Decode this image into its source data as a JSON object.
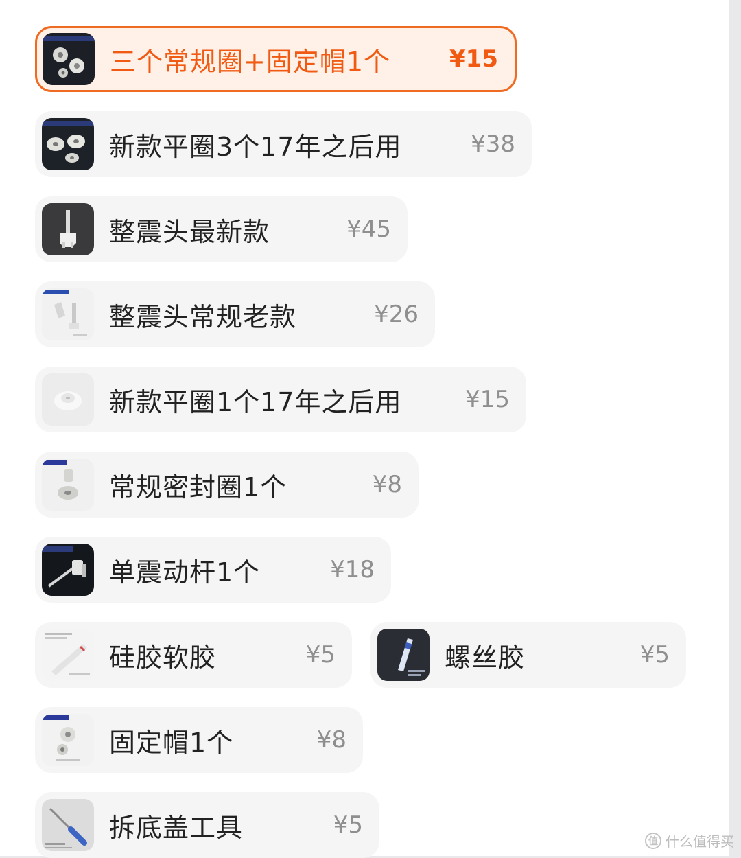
{
  "colors": {
    "accent": "#f05a12",
    "selected_border": "#f06b22",
    "option_bg": "#f5f5f5"
  },
  "options": [
    {
      "label": "三个常规圈+固定帽1个",
      "price": "¥15",
      "selected": true,
      "icon": "seal-rings-with-cap-thumbnail"
    },
    {
      "label": "新款平圈3个17年之后用",
      "price": "¥38",
      "selected": false,
      "icon": "flat-rings-thumbnail"
    },
    {
      "label": "整震头最新款",
      "price": "¥45",
      "selected": false,
      "icon": "vibration-head-new-thumbnail"
    },
    {
      "label": "整震头常规老款",
      "price": "¥26",
      "selected": false,
      "icon": "vibration-head-old-thumbnail"
    },
    {
      "label": "新款平圈1个17年之后用",
      "price": "¥15",
      "selected": false,
      "icon": "flat-ring-thumbnail"
    },
    {
      "label": "常规密封圈1个",
      "price": "¥8",
      "selected": false,
      "icon": "seal-ring-thumbnail"
    },
    {
      "label": "单震动杆1个",
      "price": "¥18",
      "selected": false,
      "icon": "vibration-rod-thumbnail"
    },
    {
      "label": "硅胶软胶",
      "price": "¥5",
      "selected": false,
      "icon": "silicone-glue-thumbnail"
    },
    {
      "label": "螺丝胶",
      "price": "¥5",
      "selected": false,
      "icon": "screw-glue-thumbnail"
    },
    {
      "label": "固定帽1个",
      "price": "¥8",
      "selected": false,
      "icon": "fixing-cap-thumbnail"
    },
    {
      "label": "拆底盖工具",
      "price": "¥5",
      "selected": false,
      "icon": "screwdriver-thumbnail"
    }
  ],
  "watermark": {
    "text": "什么值得买",
    "logo": "值"
  }
}
